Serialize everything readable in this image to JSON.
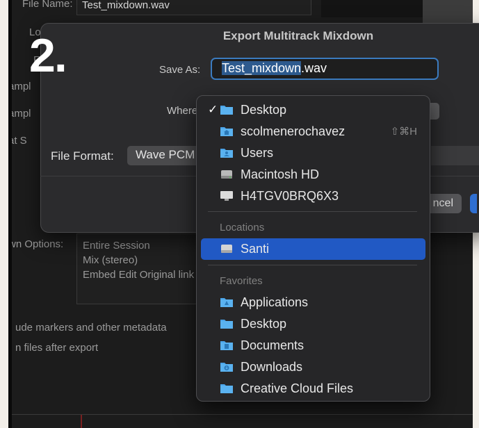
{
  "background": {
    "file_name_label": "File Name:",
    "file_name_value": "Test_mixdown.wav",
    "truncated_labels": [
      "Lo",
      "F",
      "ampl",
      "ampl",
      "at S"
    ],
    "mixdown_options_label": "wn Options:",
    "mixdown_options": [
      "Entire Session",
      "Mix (stereo)",
      "Embed Edit Original link"
    ],
    "checkbox_labels": [
      "ude markers and other metadata",
      "n files after export"
    ]
  },
  "step_number": "2.",
  "dialog": {
    "title": "Export Multitrack Mixdown",
    "save_as_label": "Save As:",
    "save_as_selected": "Test_mixdown",
    "save_as_extension": ".wav",
    "where_label": "Where",
    "file_format_label": "File Format:",
    "file_format_value": "Wave PCM",
    "cancel_label": "ncel"
  },
  "menu": {
    "items": [
      {
        "label": "Desktop",
        "icon": "folder-icon",
        "checked": true
      },
      {
        "label": "scolmenerochavez",
        "icon": "home-folder-icon",
        "shortcut": "⇧⌘H"
      },
      {
        "label": "Users",
        "icon": "folder-icon"
      },
      {
        "label": "Macintosh HD",
        "icon": "hard-drive-icon"
      },
      {
        "label": "H4TGV0BRQ6X3",
        "icon": "computer-icon"
      }
    ],
    "locations_header": "Locations",
    "locations": [
      {
        "label": "Santi",
        "icon": "drive-icon",
        "selected": true
      }
    ],
    "favorites_header": "Favorites",
    "favorites": [
      {
        "label": "Applications",
        "icon": "applications-folder-icon"
      },
      {
        "label": "Desktop",
        "icon": "folder-icon"
      },
      {
        "label": "Documents",
        "icon": "documents-folder-icon"
      },
      {
        "label": "Downloads",
        "icon": "downloads-folder-icon"
      },
      {
        "label": "Creative Cloud Files",
        "icon": "folder-icon"
      }
    ]
  },
  "colors": {
    "accent": "#2159c4",
    "folder": "#4aa3e8",
    "focus_ring": "#3b7bbf"
  }
}
